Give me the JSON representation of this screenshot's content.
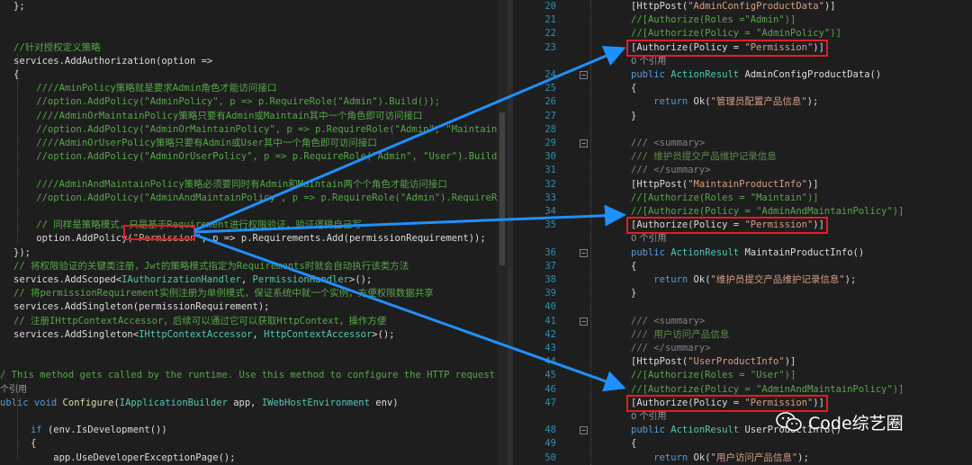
{
  "left_code": [
    {
      "segs": [
        [
          "id",
          "};"
        ]
      ]
    },
    {
      "segs": []
    },
    {
      "segs": []
    },
    {
      "segs": [
        [
          "com",
          "//针对授权定义策略"
        ]
      ]
    },
    {
      "segs": [
        [
          "id",
          "services.AddAuthorization(option =>"
        ]
      ]
    },
    {
      "segs": [
        [
          "id",
          "{"
        ]
      ]
    },
    {
      "segs": [
        [
          "com",
          "    ////AminPolicy策略就是要求Admin角色才能访问接口"
        ]
      ]
    },
    {
      "segs": [
        [
          "com",
          "    //option.AddPolicy(\"AdminPolicy\", p => p.RequireRole(\"Admin\").Build());"
        ]
      ]
    },
    {
      "segs": [
        [
          "com",
          "    ////AdminOrMaintainPolicy策略只要有Admin或Maintain其中一个角色即可访问接口"
        ]
      ]
    },
    {
      "segs": [
        [
          "com",
          "    //option.AddPolicy(\"AdminOrMaintainPolicy\", p => p.RequireRole(\"Admin\", \"Maintain\").Bu"
        ]
      ]
    },
    {
      "segs": [
        [
          "com",
          "    ////AdminOrUserPolicy策略只要有Admin或User其中一个角色即可访问接口"
        ]
      ]
    },
    {
      "segs": [
        [
          "com",
          "    //option.AddPolicy(\"AdminOrUserPolicy\", p => p.RequireRole(\"Admin\", \"User\").Build());"
        ]
      ]
    },
    {
      "segs": []
    },
    {
      "segs": [
        [
          "com",
          "    ////AdminAndMaintainPolicy策略必须要同时有Admin和Maintain两个个角色才能访问接口"
        ]
      ]
    },
    {
      "segs": [
        [
          "com",
          "    //option.AddPolicy(\"AdminAndMaintainPolicy\", p => p.RequireRole(\"Admin\").RequireRole(\""
        ]
      ]
    },
    {
      "segs": []
    },
    {
      "segs": [
        [
          "com",
          "    // 同样是策略模式，只是基于Requirement进行权限验证，验证逻辑自己写"
        ]
      ]
    },
    {
      "segs": [
        [
          "id",
          "    option.AddPolicy("
        ],
        [
          "str",
          "\"Permission\""
        ],
        [
          "id",
          ", p => p.Requirements.Add(permissionRequirement));"
        ]
      ]
    },
    {
      "segs": [
        [
          "id",
          "});"
        ]
      ]
    },
    {
      "segs": [
        [
          "com",
          "// 将权限验证的关键类注册，Jwt的策略模式指定为Requirements时就会自动执行该类方法"
        ]
      ]
    },
    {
      "segs": [
        [
          "id",
          "services.AddScoped<"
        ],
        [
          "type",
          "IAuthorizationHandler"
        ],
        [
          "id",
          ", "
        ],
        [
          "type",
          "PermissionHandler"
        ],
        [
          "id",
          ">();"
        ]
      ]
    },
    {
      "segs": [
        [
          "com",
          "// 将permissionRequirement实例注册为单例模式，保证系统中就一个实例，方便权限数据共享"
        ]
      ]
    },
    {
      "segs": [
        [
          "id",
          "services.AddSingleton(permissionRequirement);"
        ]
      ]
    },
    {
      "segs": [
        [
          "com",
          "// 注册IHttpContextAccessor，后续可以通过它可以获取HttpContext，操作方便"
        ]
      ]
    },
    {
      "segs": [
        [
          "id",
          "services.AddSingleton<"
        ],
        [
          "type",
          "IHttpContextAccessor"
        ],
        [
          "id",
          ", "
        ],
        [
          "type",
          "HttpContextAccessor"
        ],
        [
          "id",
          ">();"
        ]
      ]
    },
    {
      "segs": []
    },
    {
      "segs": []
    },
    {
      "segs": [
        [
          "com",
          "/ This method gets called by the runtime. Use this method to configure the HTTP request pipel"
        ]
      ]
    },
    {
      "segs": [
        [
          "ref",
          "个引用"
        ]
      ]
    },
    {
      "segs": [
        [
          "kw",
          "ublic void "
        ],
        [
          "meth",
          "Configure"
        ],
        [
          "id",
          "("
        ],
        [
          "type",
          "IApplicationBuilder"
        ],
        [
          "id",
          " app, "
        ],
        [
          "type",
          "IWebHostEnvironment"
        ],
        [
          "id",
          " env)"
        ]
      ]
    },
    {
      "segs": []
    },
    {
      "segs": [
        [
          "kw",
          "   if "
        ],
        [
          "id",
          "(env.IsDevelopment())"
        ]
      ]
    },
    {
      "segs": [
        [
          "id",
          "   {"
        ]
      ]
    },
    {
      "segs": [
        [
          "id",
          "       app.UseDeveloperExceptionPage();"
        ]
      ]
    },
    {
      "segs": [
        [
          "id",
          "   }"
        ]
      ]
    }
  ],
  "right_code": [
    {
      "n": "20",
      "segs": [
        [
          "id",
          "[HttpPost("
        ],
        [
          "str",
          "\"AdminConfigProductData\""
        ],
        [
          "id",
          ")]"
        ]
      ]
    },
    {
      "n": "21",
      "segs": [
        [
          "com",
          "//[Authorize(Roles =\"Admin\")]"
        ]
      ]
    },
    {
      "n": "22",
      "segs": [
        [
          "com",
          "//[Authorize(Policy = \"AdminPolicy\")]"
        ]
      ]
    },
    {
      "n": "23",
      "segs": [
        [
          "id",
          "[Authorize(Policy = "
        ],
        [
          "str",
          "\"Permission\""
        ],
        [
          "id",
          ")]"
        ]
      ]
    },
    {
      "n": "",
      "segs": [
        [
          "ref",
          "0 个引用"
        ]
      ]
    },
    {
      "n": "24",
      "segs": [
        [
          "kw",
          "public "
        ],
        [
          "type",
          "ActionResult"
        ],
        [
          "id",
          " AdminConfigProductData()"
        ]
      ]
    },
    {
      "n": "25",
      "segs": [
        [
          "id",
          "{"
        ]
      ]
    },
    {
      "n": "26",
      "segs": [
        [
          "kw",
          "    return "
        ],
        [
          "id",
          "Ok("
        ],
        [
          "str",
          "\"管理员配置产品信息\""
        ],
        [
          "id",
          ");"
        ]
      ]
    },
    {
      "n": "27",
      "segs": [
        [
          "id",
          "}"
        ]
      ]
    },
    {
      "n": "28",
      "segs": []
    },
    {
      "n": "29",
      "segs": [
        [
          "docgray",
          "/// "
        ],
        [
          "docgray",
          "<summary>"
        ]
      ]
    },
    {
      "n": "30",
      "segs": [
        [
          "doc",
          "/// 维护员提交产品维护记录信息"
        ]
      ]
    },
    {
      "n": "31",
      "segs": [
        [
          "docgray",
          "/// "
        ],
        [
          "docgray",
          "</summary>"
        ]
      ]
    },
    {
      "n": "32",
      "segs": [
        [
          "id",
          "[HttpPost("
        ],
        [
          "str",
          "\"MaintainProductInfo\""
        ],
        [
          "id",
          ")]"
        ]
      ]
    },
    {
      "n": "33",
      "segs": [
        [
          "com",
          "//[Authorize(Roles = \"Maintain\")]"
        ]
      ]
    },
    {
      "n": "34",
      "segs": [
        [
          "com",
          "//[Authorize(Policy = \"AdminAndMaintainPolicy\")]"
        ]
      ]
    },
    {
      "n": "35",
      "segs": [
        [
          "id",
          "[Authorize(Policy = "
        ],
        [
          "str",
          "\"Permission\""
        ],
        [
          "id",
          ")]"
        ]
      ]
    },
    {
      "n": "",
      "segs": [
        [
          "ref",
          "0 个引用"
        ]
      ]
    },
    {
      "n": "36",
      "segs": [
        [
          "kw",
          "public "
        ],
        [
          "type",
          "ActionResult"
        ],
        [
          "id",
          " MaintainProductInfo()"
        ]
      ]
    },
    {
      "n": "37",
      "segs": [
        [
          "id",
          "{"
        ]
      ]
    },
    {
      "n": "38",
      "segs": [
        [
          "kw",
          "    return "
        ],
        [
          "id",
          "Ok("
        ],
        [
          "str",
          "\"维护员提交产品维护记录信息\""
        ],
        [
          "id",
          ");"
        ]
      ]
    },
    {
      "n": "39",
      "segs": [
        [
          "id",
          "}"
        ]
      ]
    },
    {
      "n": "40",
      "segs": []
    },
    {
      "n": "41",
      "segs": [
        [
          "docgray",
          "/// "
        ],
        [
          "docgray",
          "<summary>"
        ]
      ]
    },
    {
      "n": "42",
      "segs": [
        [
          "doc",
          "/// 用户访问产品信息"
        ]
      ]
    },
    {
      "n": "43",
      "segs": [
        [
          "docgray",
          "/// "
        ],
        [
          "docgray",
          "</summary>"
        ]
      ]
    },
    {
      "n": "44",
      "segs": [
        [
          "id",
          "[HttpPost("
        ],
        [
          "str",
          "\"UserProductInfo\""
        ],
        [
          "id",
          ")]"
        ]
      ]
    },
    {
      "n": "45",
      "segs": [
        [
          "com",
          "//[Authorize(Roles = \"User\")]"
        ]
      ]
    },
    {
      "n": "46",
      "segs": [
        [
          "com",
          "//[Authorize(Policy = \"AdminAndMaintainPolicy\")]"
        ]
      ]
    },
    {
      "n": "47",
      "segs": [
        [
          "id",
          "[Authorize(Policy = "
        ],
        [
          "str",
          "\"Permission\""
        ],
        [
          "id",
          ")]"
        ]
      ]
    },
    {
      "n": "",
      "segs": [
        [
          "ref",
          "0 个引用"
        ]
      ]
    },
    {
      "n": "48",
      "segs": [
        [
          "kw",
          "public "
        ],
        [
          "type",
          "ActionResult"
        ],
        [
          "id",
          " UserProductInfo()"
        ]
      ]
    },
    {
      "n": "49",
      "segs": [
        [
          "id",
          "{"
        ]
      ]
    },
    {
      "n": "50",
      "segs": [
        [
          "kw",
          "    return "
        ],
        [
          "id",
          "Ok("
        ],
        [
          "str",
          "\"用户访问产品信息\""
        ],
        [
          "id",
          ");"
        ]
      ]
    },
    {
      "n": "51",
      "segs": [
        [
          "id",
          "}"
        ]
      ]
    }
  ],
  "watermark": {
    "text": "Code综艺圈"
  },
  "colors": {
    "highlight_box": "#e51c23",
    "arrow": "#1e90ff",
    "line_number": "#2b91af"
  }
}
